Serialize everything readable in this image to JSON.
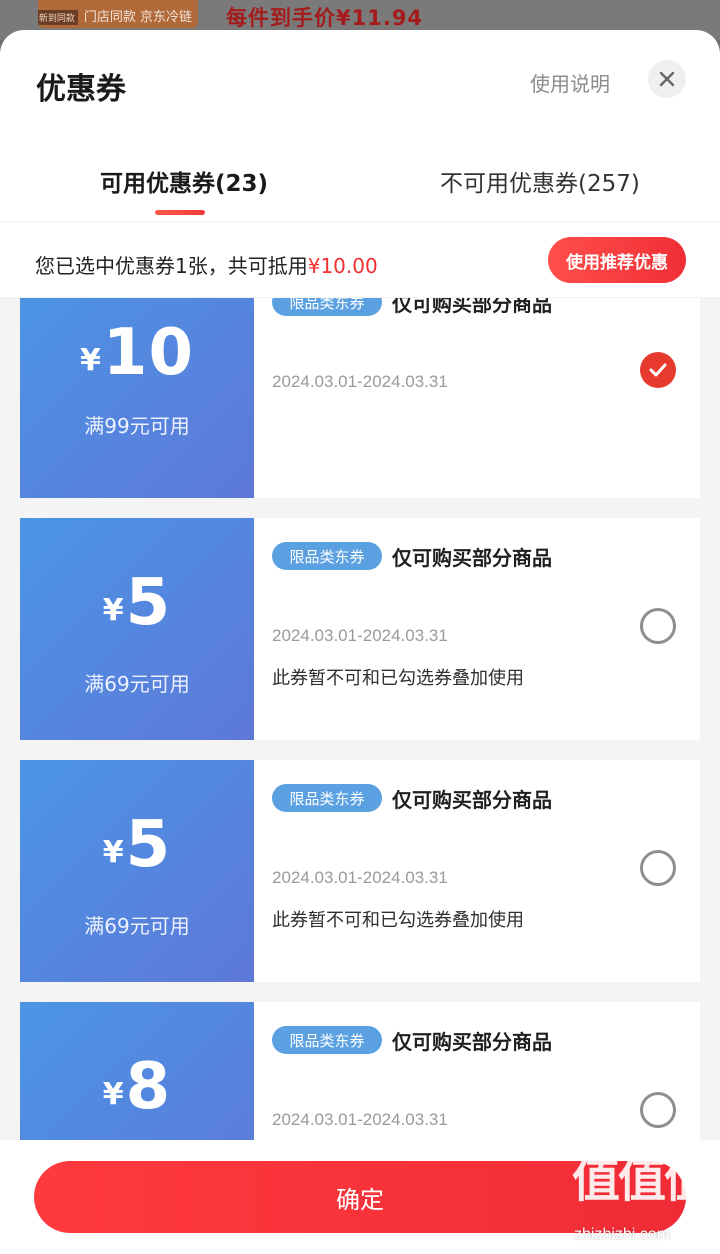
{
  "background": {
    "thumb_tag": "新到同款",
    "thumb_label": "门店同款 京东冷链",
    "price_text": "每件到手价¥11.94"
  },
  "sheet": {
    "title": "优惠券",
    "help_label": "使用说明",
    "close_icon": "close-icon"
  },
  "tabs": {
    "available": "可用优惠券(23)",
    "unavailable": "不可用优惠券(257)",
    "active": "available"
  },
  "summary": {
    "text": "您已选中优惠券1张，共可抵用",
    "amount": "¥10.00",
    "recommend_label": "使用推荐优惠"
  },
  "coupons": [
    {
      "currency": "¥",
      "amount": "10",
      "condition": "满99元可用",
      "badge": "限品类东券",
      "desc": "仅可购买部分商品",
      "validity": "2024.03.01-2024.03.31",
      "warning": "",
      "selected": true
    },
    {
      "currency": "¥",
      "amount": "5",
      "condition": "满69元可用",
      "badge": "限品类东券",
      "desc": "仅可购买部分商品",
      "validity": "2024.03.01-2024.03.31",
      "warning": "此券暂不可和已勾选券叠加使用",
      "selected": false
    },
    {
      "currency": "¥",
      "amount": "5",
      "condition": "满69元可用",
      "badge": "限品类东券",
      "desc": "仅可购买部分商品",
      "validity": "2024.03.01-2024.03.31",
      "warning": "此券暂不可和已勾选券叠加使用",
      "selected": false
    },
    {
      "currency": "¥",
      "amount": "8",
      "condition": "",
      "badge": "限品类东券",
      "desc": "仅可购买部分商品",
      "validity": "2024.03.01-2024.03.31",
      "warning": "",
      "selected": false
    }
  ],
  "footer": {
    "confirm_label": "确定"
  },
  "watermark": {
    "mark": "值值值",
    "url": "zhizhizhi.com"
  },
  "colors": {
    "accent_red": "#f02b36",
    "coupon_blue_start": "#4b95e5",
    "coupon_blue_end": "#5e78d8",
    "badge_blue": "#5ba1e2"
  }
}
